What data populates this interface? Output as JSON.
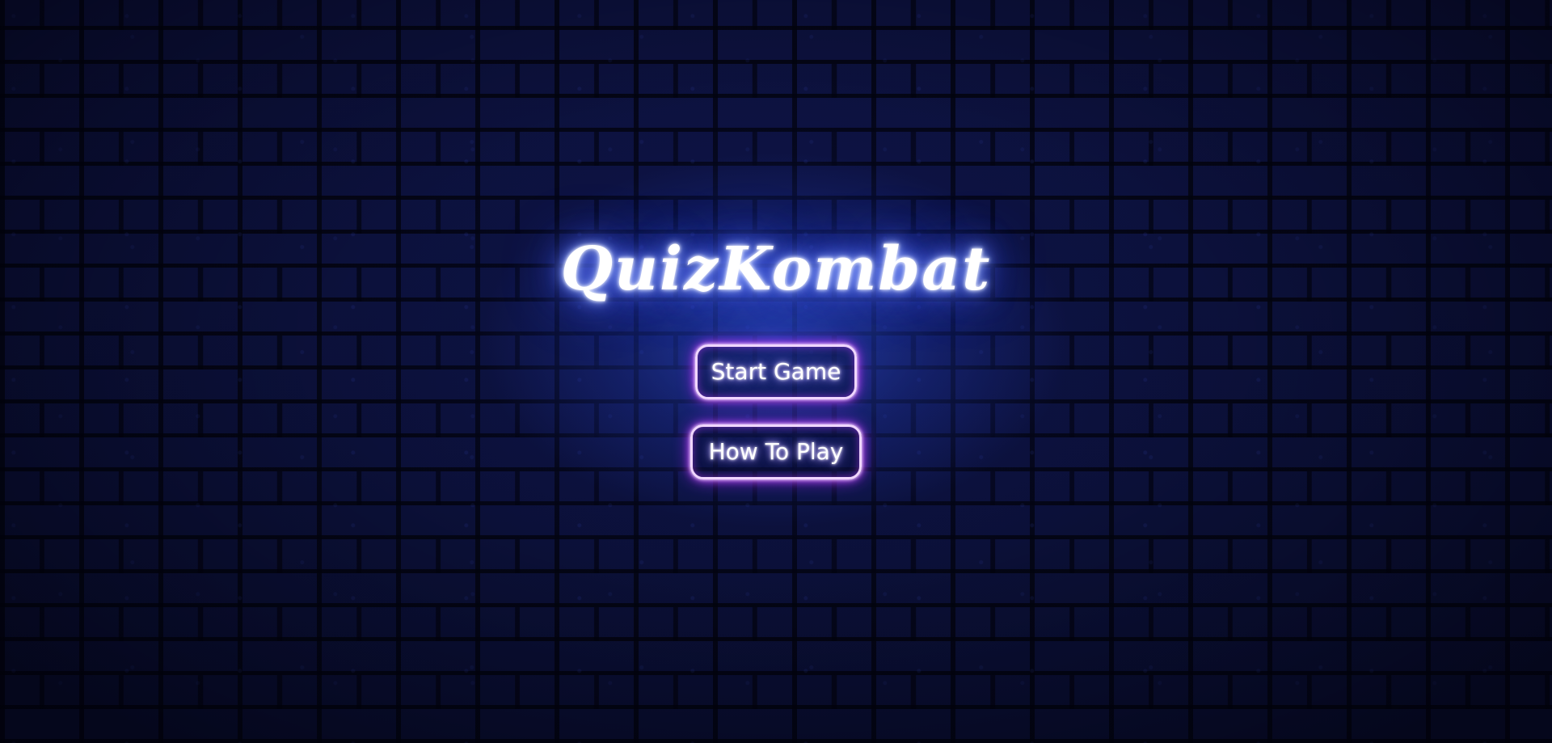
{
  "app": {
    "title": "QuizKombat"
  },
  "menu": {
    "start_label": "Start Game",
    "howto_label": "How To Play"
  },
  "colors": {
    "background": "#0b1038",
    "title_glow": "#4b63ff",
    "button_border": "#f0d6ff",
    "button_glow": "#a020f0"
  }
}
